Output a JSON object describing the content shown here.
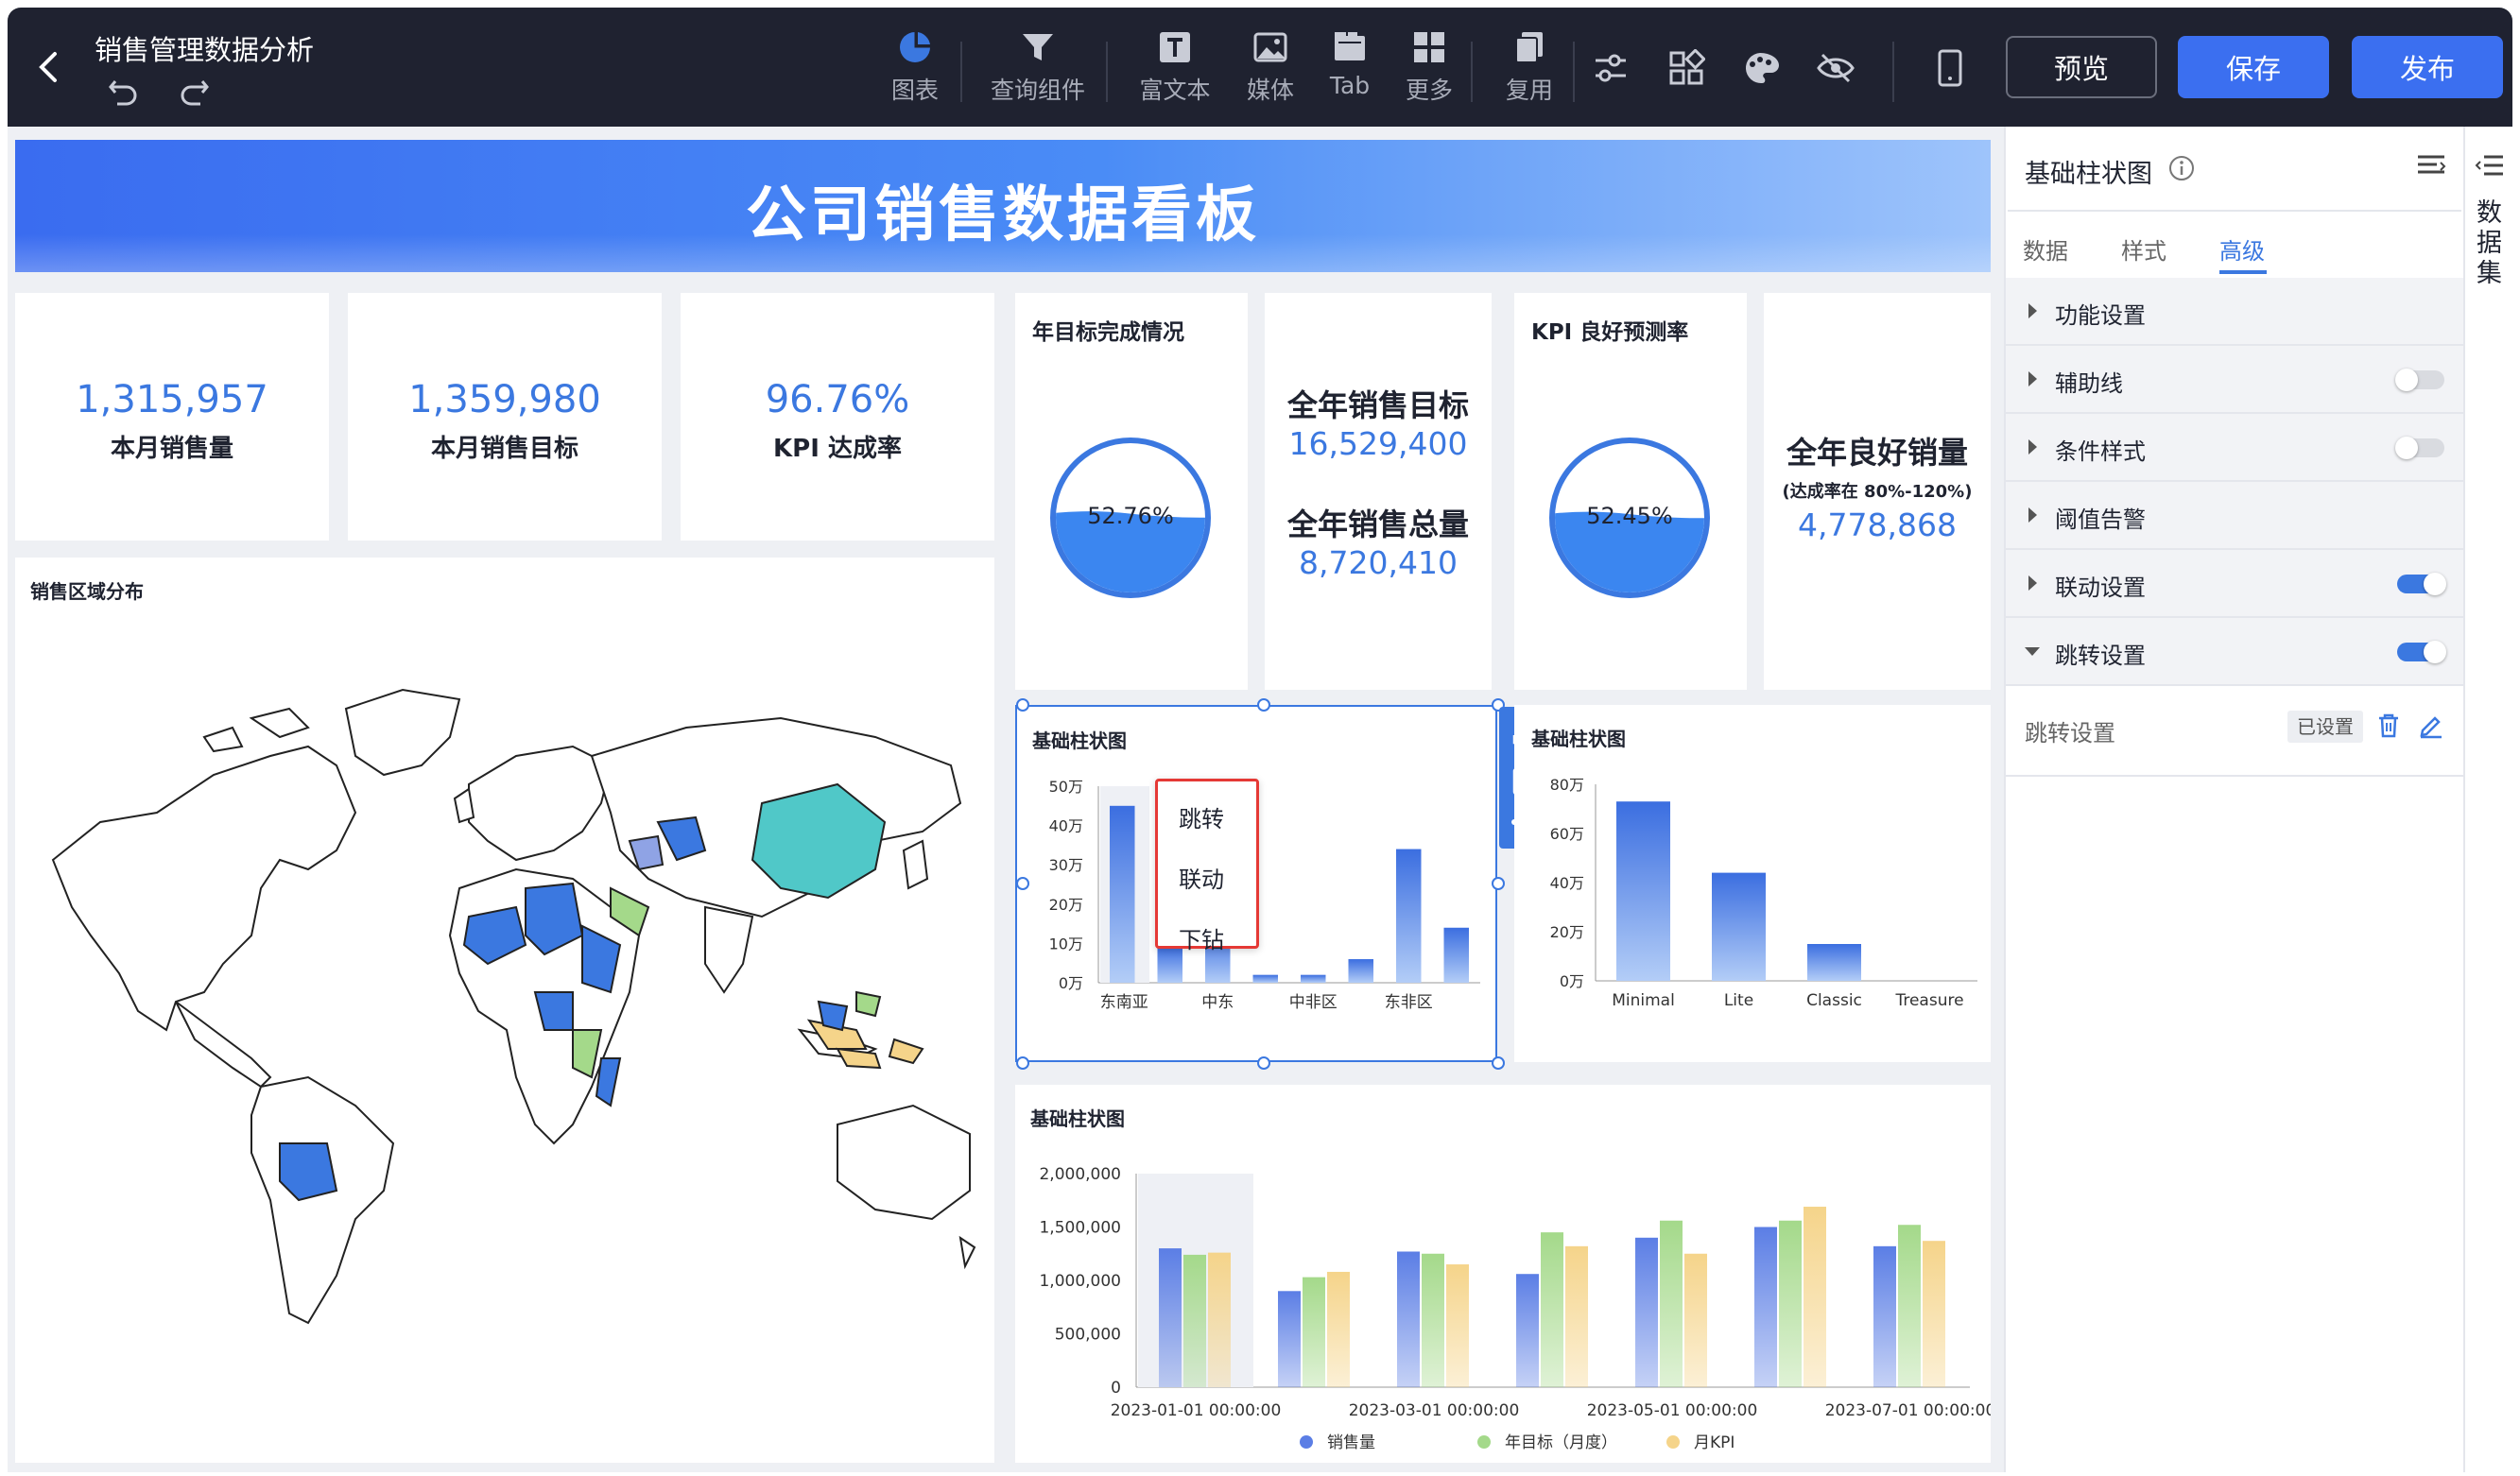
{
  "app": {
    "title": "销售管理数据分析"
  },
  "toolbar": {
    "items": [
      {
        "label": "图表",
        "icon": "pie-chart-icon"
      },
      {
        "label": "查询组件",
        "icon": "funnel-icon"
      },
      {
        "label": "富文本",
        "icon": "text-box-icon"
      },
      {
        "label": "媒体",
        "icon": "image-icon"
      },
      {
        "label": "Tab",
        "icon": "tab-icon"
      },
      {
        "label": "更多",
        "icon": "grid-icon"
      },
      {
        "label": "复用",
        "icon": "copy-icon"
      }
    ],
    "preview": "预览",
    "save": "保存",
    "publish": "发布"
  },
  "dashboard": {
    "banner_title": "公司销售数据看板",
    "kpis": [
      {
        "value": "1,315,957",
        "label": "本月销售量"
      },
      {
        "value": "1,359,980",
        "label": "本月销售目标"
      },
      {
        "value": "96.76%",
        "label": "KPI 达成率"
      }
    ],
    "gauge1": {
      "title": "年目标完成情况",
      "value": "52.76%",
      "fill": 0.5276
    },
    "targets": {
      "target_label": "全年销售目标",
      "target_value": "16,529,400",
      "total_label": "全年销售总量",
      "total_value": "8,720,410"
    },
    "gauge2": {
      "title": "KPI 良好预测率",
      "value": "52.45%",
      "fill": 0.5245
    },
    "good": {
      "label": "全年良好销量",
      "sub": "(达成率在 80%-120%)",
      "value": "4,778,868"
    },
    "map_title": "销售区域分布",
    "context_menu": [
      "跳转",
      "联动",
      "下钻"
    ]
  },
  "chart_data": [
    {
      "type": "bar",
      "title": "基础柱状图",
      "categories": [
        "东南亚",
        "",
        "中东",
        "",
        "中非区",
        "",
        "东非区"
      ],
      "values": [
        450000,
        90000,
        130000,
        20000,
        20000,
        60000,
        340000,
        140000
      ],
      "ylim": [
        0,
        500000
      ],
      "yticks": [
        "0万",
        "10万",
        "20万",
        "30万",
        "40万",
        "50万"
      ],
      "xticks": [
        "东南亚",
        "中东",
        "中非区",
        "东非区"
      ]
    },
    {
      "type": "bar",
      "title": "基础柱状图",
      "categories": [
        "Minimal",
        "Lite",
        "Classic",
        "Treasure"
      ],
      "values": [
        730000,
        440000,
        150000,
        0
      ],
      "ylim": [
        0,
        800000
      ],
      "yticks": [
        "0万",
        "20万",
        "40万",
        "60万",
        "80万"
      ]
    },
    {
      "type": "bar",
      "title": "基础柱状图",
      "categories": [
        "2023-01",
        "2023-02",
        "2023-03",
        "2023-04",
        "2023-05",
        "2023-06",
        "2023-07"
      ],
      "xticks": [
        "2023-01-01 00:00:00",
        "2023-03-01 00:00:00",
        "2023-05-01 00:00:00",
        "2023-07-01 00:00:00"
      ],
      "yticks": [
        "0",
        "500,000",
        "1,000,000",
        "1,500,000",
        "2,000,000"
      ],
      "ylim": [
        0,
        2000000
      ],
      "series": [
        {
          "name": "销售量",
          "values": [
            1300000,
            900000,
            1270000,
            1060000,
            1400000,
            1500000,
            1320000
          ],
          "color": "#5b7ee5"
        },
        {
          "name": "年目标（月度）",
          "values": [
            1240000,
            1030000,
            1250000,
            1450000,
            1560000,
            1560000,
            1520000
          ],
          "color": "#a4d98a"
        },
        {
          "name": "月KPI",
          "values": [
            1260000,
            1080000,
            1150000,
            1320000,
            1250000,
            1690000,
            1370000
          ],
          "color": "#f5d48a"
        }
      ]
    }
  ],
  "panel": {
    "title": "基础柱状图",
    "tabs": [
      "数据",
      "样式",
      "高级"
    ],
    "rows": [
      {
        "label": "功能设置",
        "toggle": "none"
      },
      {
        "label": "辅助线",
        "toggle": "off"
      },
      {
        "label": "条件样式",
        "toggle": "off"
      },
      {
        "label": "阈值告警",
        "toggle": "none"
      },
      {
        "label": "联动设置",
        "toggle": "on"
      },
      {
        "label": "跳转设置",
        "toggle": "on"
      }
    ],
    "jump_label": "跳转设置",
    "jump_status": "已设置"
  },
  "rail": {
    "label": "数据集"
  },
  "colors": {
    "accent": "#3b78e0",
    "topbar": "#1f2230",
    "publish": "#3b6ff0",
    "highlight": "#e53935"
  }
}
